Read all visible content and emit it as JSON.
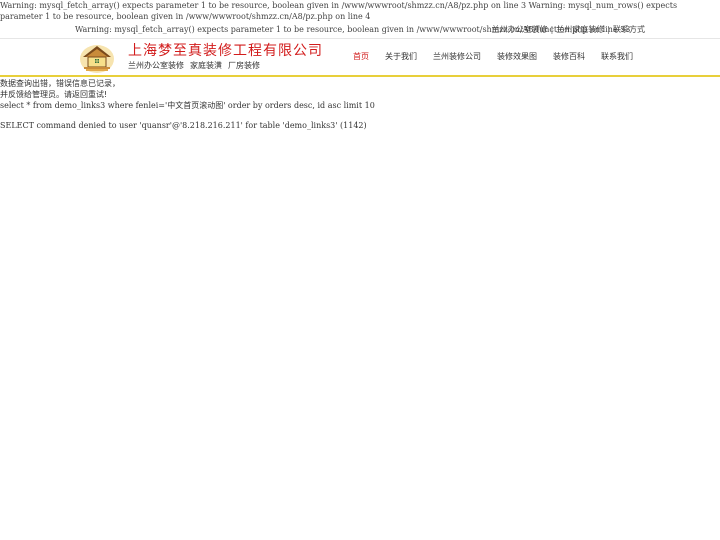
{
  "warnings": {
    "top": "Warning: mysql_fetch_array() expects parameter 1 to be resource, boolean given in /www/wwwroot/shmzz.cn/A8/pz.php on line 3 Warning: mysql_num_rows() expects parameter 1 to be resource, boolean given in /www/wwwroot/shmzz.cn/A8/pz.php on line 4",
    "function": "Warning: mysql_fetch_array() expects parameter 1 to be resource, boolean given in /www/wwwroot/shmzz.cn/A8/function.php on line 53"
  },
  "top_links": {
    "office": "兰州办公室装修",
    "home": "兰州家庭装修",
    "contact": "联系方式",
    "separator": "|"
  },
  "brand": {
    "name": "上海梦至真装修工程有限公司",
    "sub1": "兰州办公室装修",
    "sub2": "家庭装潢",
    "sub3": "厂房装修"
  },
  "nav": {
    "items": [
      {
        "label": "首页",
        "active": true
      },
      {
        "label": "关于我们"
      },
      {
        "label": "兰州装修公司"
      },
      {
        "label": "装修效果图"
      },
      {
        "label": "装修百科"
      },
      {
        "label": "联系我们"
      }
    ]
  },
  "error": {
    "line1": "数据查询出错，错误信息已记录，",
    "line2": "并反馈给管理员。请返回重试!",
    "line3": "select * from demo_links3 where fenlei='中文首页滚动图' order by orders desc, id asc limit 10",
    "denied": "SELECT command denied to user 'quansr'@'8.218.216.211' for table 'demo_links3' (1142)"
  },
  "colors": {
    "brand_red": "#d21c1c",
    "accent_yellow": "#e8cf3a"
  },
  "icons": {
    "logo": "house-logo-icon"
  }
}
